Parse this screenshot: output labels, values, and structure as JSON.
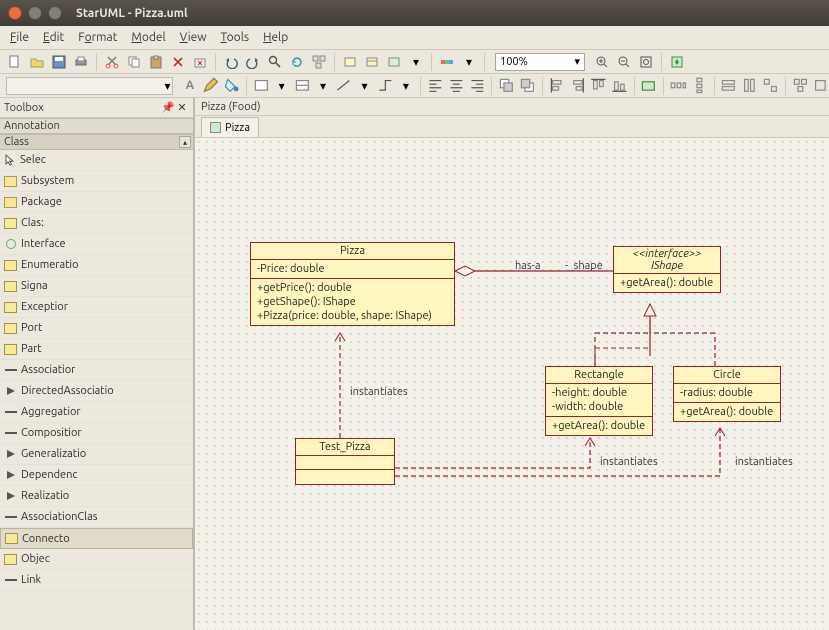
{
  "window": {
    "title": "StarUML - Pizza.uml"
  },
  "menu": {
    "file": "File",
    "edit": "Edit",
    "format": "Format",
    "model": "Model",
    "view": "View",
    "tools": "Tools",
    "help": "Help"
  },
  "toolbar": {
    "zoom": "100%"
  },
  "toolbox": {
    "title": "Toolbox",
    "sections": {
      "annotation": "Annotation",
      "class": "Class"
    },
    "items": [
      {
        "label": "Selec",
        "icon": "cursor"
      },
      {
        "label": "Subsystem",
        "icon": "folder"
      },
      {
        "label": "Package",
        "icon": "folder"
      },
      {
        "label": "Clas:",
        "icon": "class"
      },
      {
        "label": "Interface",
        "icon": "lolli"
      },
      {
        "label": "Enumeratio",
        "icon": "class"
      },
      {
        "label": "Signa",
        "icon": "class"
      },
      {
        "label": "Exceptior",
        "icon": "class"
      },
      {
        "label": "Port",
        "icon": "class"
      },
      {
        "label": "Part",
        "icon": "class"
      },
      {
        "label": "Associatior",
        "icon": "line"
      },
      {
        "label": "DirectedAssociatio",
        "icon": "arrow"
      },
      {
        "label": "Aggregatior",
        "icon": "line"
      },
      {
        "label": "Compositior",
        "icon": "line"
      },
      {
        "label": "Generalizatio",
        "icon": "arrow"
      },
      {
        "label": "Dependenc",
        "icon": "arrow"
      },
      {
        "label": "Realizatio",
        "icon": "arrow"
      },
      {
        "label": "AssociationClas",
        "icon": "line"
      },
      {
        "label": "Connecto",
        "icon": "connect",
        "sel": true
      },
      {
        "label": "Objec",
        "icon": "class"
      },
      {
        "label": "Link",
        "icon": "line"
      }
    ]
  },
  "diagram": {
    "path": "Pizza (Food)",
    "tab": "Pizza",
    "pizza": {
      "name": "Pizza",
      "attrs": [
        "-Price: double"
      ],
      "ops": [
        "+getPrice(): double",
        "+getShape(): IShape",
        "+Pizza(price: double, shape: IShape)"
      ]
    },
    "ishape": {
      "stereo": "<<interface>>",
      "name": "IShape",
      "ops": [
        "+getArea(): double"
      ]
    },
    "rectangle": {
      "name": "Rectangle",
      "attrs": [
        "-height: double",
        "-width: double"
      ],
      "ops": [
        "+getArea(): double"
      ]
    },
    "circle": {
      "name": "Circle",
      "attrs": [
        "-radius: double"
      ],
      "ops": [
        "+getArea(): double"
      ]
    },
    "test": {
      "name": "Test_Pizza"
    },
    "labels": {
      "hasa": "has-a",
      "shape": "-_shape",
      "inst": "instantiates"
    }
  }
}
